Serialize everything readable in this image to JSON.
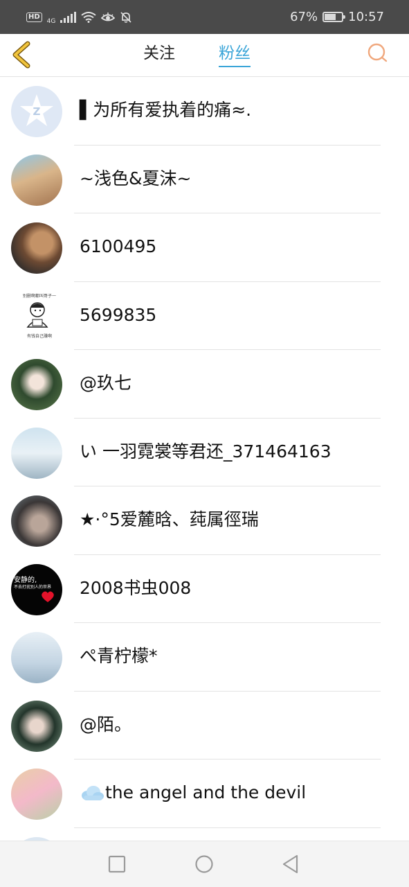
{
  "status_bar": {
    "hd": "HD",
    "network": "4G",
    "battery": "67%",
    "battery_level": 0.67,
    "time": "10:57"
  },
  "header": {
    "back_icon": "chevron-left-icon",
    "tabs": [
      {
        "label": "关注",
        "active": false
      },
      {
        "label": "粉丝",
        "active": true
      }
    ],
    "search_icon": "search-icon",
    "accent_color": "#3aa5d8",
    "back_color": "#f2c53d"
  },
  "fans": [
    {
      "name": "▌为所有爱执着的痛≈.",
      "avatar": "default-qq-avatar"
    },
    {
      "name": "~浅色&夏沫~",
      "avatar": "photo-avatar"
    },
    {
      "name": "6100495",
      "avatar": "photo-avatar"
    },
    {
      "name": "5699835",
      "avatar": "cartoon-avatar",
      "avatar_text_top": "别删啊都叫哥子一",
      "avatar_text_bottom": "有钱自己赚啊"
    },
    {
      "name": "@玖七",
      "avatar": "photo-avatar"
    },
    {
      "name": "い 一羽霓裳等君还_371464163",
      "avatar": "photo-avatar"
    },
    {
      "name": "★·°5爱麓晗、莼属徑瑞",
      "avatar": "photo-avatar"
    },
    {
      "name": "2008书虫008",
      "avatar": "text-avatar",
      "avatar_text_top": "安静的,",
      "avatar_text_bottom": "不去打扰别人的世界"
    },
    {
      "name": "ぺ青柠檬*",
      "avatar": "photo-avatar"
    },
    {
      "name": "@陌。",
      "avatar": "photo-avatar"
    },
    {
      "name": "the angel and the devil",
      "avatar": "photo-avatar",
      "prefix_icon": "cloud-icon"
    },
    {
      "name": "",
      "avatar": "default-qq-avatar"
    }
  ],
  "bottom_nav": {
    "recent_icon": "recent-apps-icon",
    "home_icon": "home-icon",
    "back_icon": "back-triangle-icon"
  }
}
